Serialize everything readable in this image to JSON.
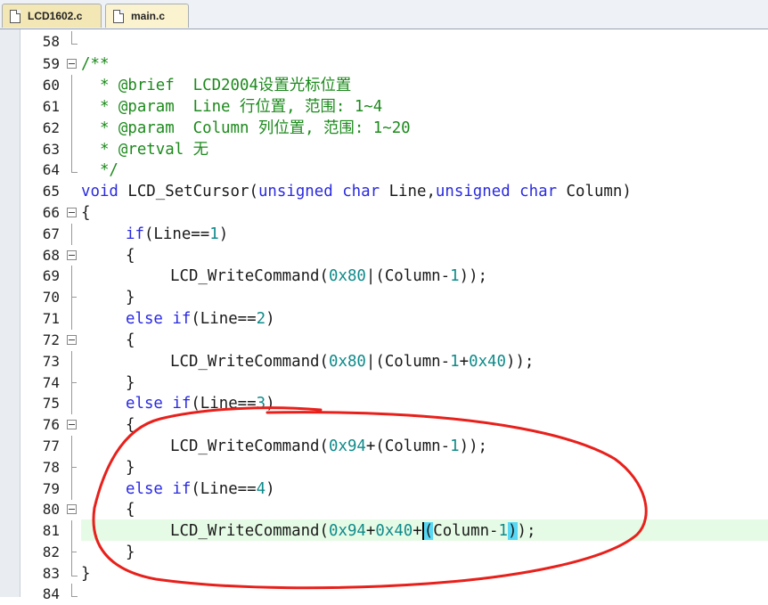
{
  "tabs": [
    {
      "label": "LCD1602.c",
      "active": true
    },
    {
      "label": "main.c",
      "active": false
    }
  ],
  "line_numbers": [
    "58",
    "59",
    "60",
    "61",
    "62",
    "63",
    "64",
    "65",
    "66",
    "67",
    "68",
    "69",
    "70",
    "71",
    "72",
    "73",
    "74",
    "75",
    "76",
    "77",
    "78",
    "79",
    "80",
    "81",
    "82",
    "83",
    "84"
  ],
  "code": {
    "l59": "/**",
    "l60_tag": "  * @brief  ",
    "l60_text": "LCD2004设置光标位置",
    "l61_tag": "  * @param  ",
    "l61_text": "Line 行位置, 范围: 1~4",
    "l62_tag": "  * @param  ",
    "l62_text": "Column 列位置, 范围: 1~20",
    "l63_tag": "  * @retval ",
    "l63_text": "无",
    "l64": "  */",
    "l65_void": "void",
    "l65_name": " LCD_SetCursor(",
    "l65_unsigned1": "unsigned",
    "l65_sp1": " ",
    "l65_char1": "char",
    "l65_line": " Line,",
    "l65_unsigned2": "unsigned",
    "l65_sp2": " ",
    "l65_char2": "char",
    "l65_col": " Column)",
    "l66": "{",
    "l67_if": "if",
    "l67_cond": "(Line==",
    "l67_n": "1",
    "l67_close": ")",
    "open_brace": "{",
    "close_brace": "}",
    "l69_call": "LCD_WriteCommand(",
    "l69_hex": "0x80",
    "l69_mid": "|(Column-",
    "l69_one": "1",
    "l69_end": "));",
    "l71_else": "else",
    "l71_if": "if",
    "l71_cond": "(Line==",
    "l71_n": "2",
    "l71_close": ")",
    "l73_call": "LCD_WriteCommand(",
    "l73_hex": "0x80",
    "l73_mid": "|(Column-",
    "l73_one": "1",
    "l73_plus": "+",
    "l73_hex2": "0x40",
    "l73_end": "));",
    "l75_else": "else",
    "l75_if": "if",
    "l75_cond": "(Line==",
    "l75_n": "3",
    "l75_close": ")",
    "l77_call": "LCD_WriteCommand(",
    "l77_hex": "0x94",
    "l77_mid": "+(Column-",
    "l77_one": "1",
    "l77_end": "));",
    "l79_else": "else",
    "l79_if": "if",
    "l79_cond": "(Line==",
    "l79_n": "4",
    "l79_close": ")",
    "l81_call": "LCD_WriteCommand(",
    "l81_hex": "0x94",
    "l81_plus": "+",
    "l81_hex2": "0x40",
    "l81_plus2": "+",
    "l81_open": "(",
    "l81_mid": "Column-",
    "l81_one": "1",
    "l81_close": ")",
    "l81_end": ");",
    "l83": "}"
  },
  "colors": {
    "keyword": "#2a2ae0",
    "number": "#0f8a8a",
    "comment": "#1c8a1c",
    "current_line": "#e6fbe6",
    "brace_match": "#59d8f5",
    "annotation": "#e8201b"
  }
}
